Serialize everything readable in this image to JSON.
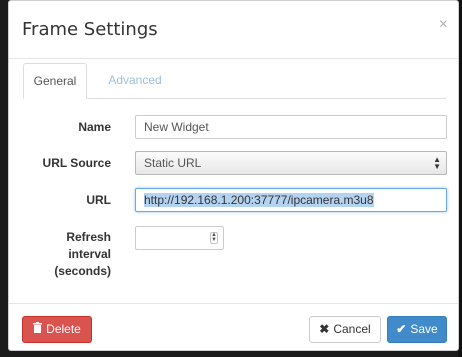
{
  "dialog": {
    "title": "Frame Settings",
    "close_glyph": "×"
  },
  "tabs": [
    {
      "label": "General",
      "active": true
    },
    {
      "label": "Advanced",
      "active": false
    }
  ],
  "form": {
    "name": {
      "label": "Name",
      "value": "New Widget"
    },
    "url_source": {
      "label": "URL Source",
      "value": "Static URL"
    },
    "url": {
      "label": "URL",
      "value": "http://192.168.1.200:37777/ipcamera.m3u8"
    },
    "refresh": {
      "label_line1": "Refresh",
      "label_line2": "interval",
      "label_line3": "(seconds)",
      "value": ""
    }
  },
  "footer": {
    "delete_label": "Delete",
    "cancel_label": "Cancel",
    "save_label": "Save"
  },
  "icons": {
    "delete": "trash-icon",
    "cancel": "times-icon",
    "save": "check-icon"
  },
  "colors": {
    "delete": "#d9534f",
    "save": "#428bca",
    "tab_inactive": "#9dbfdc"
  }
}
